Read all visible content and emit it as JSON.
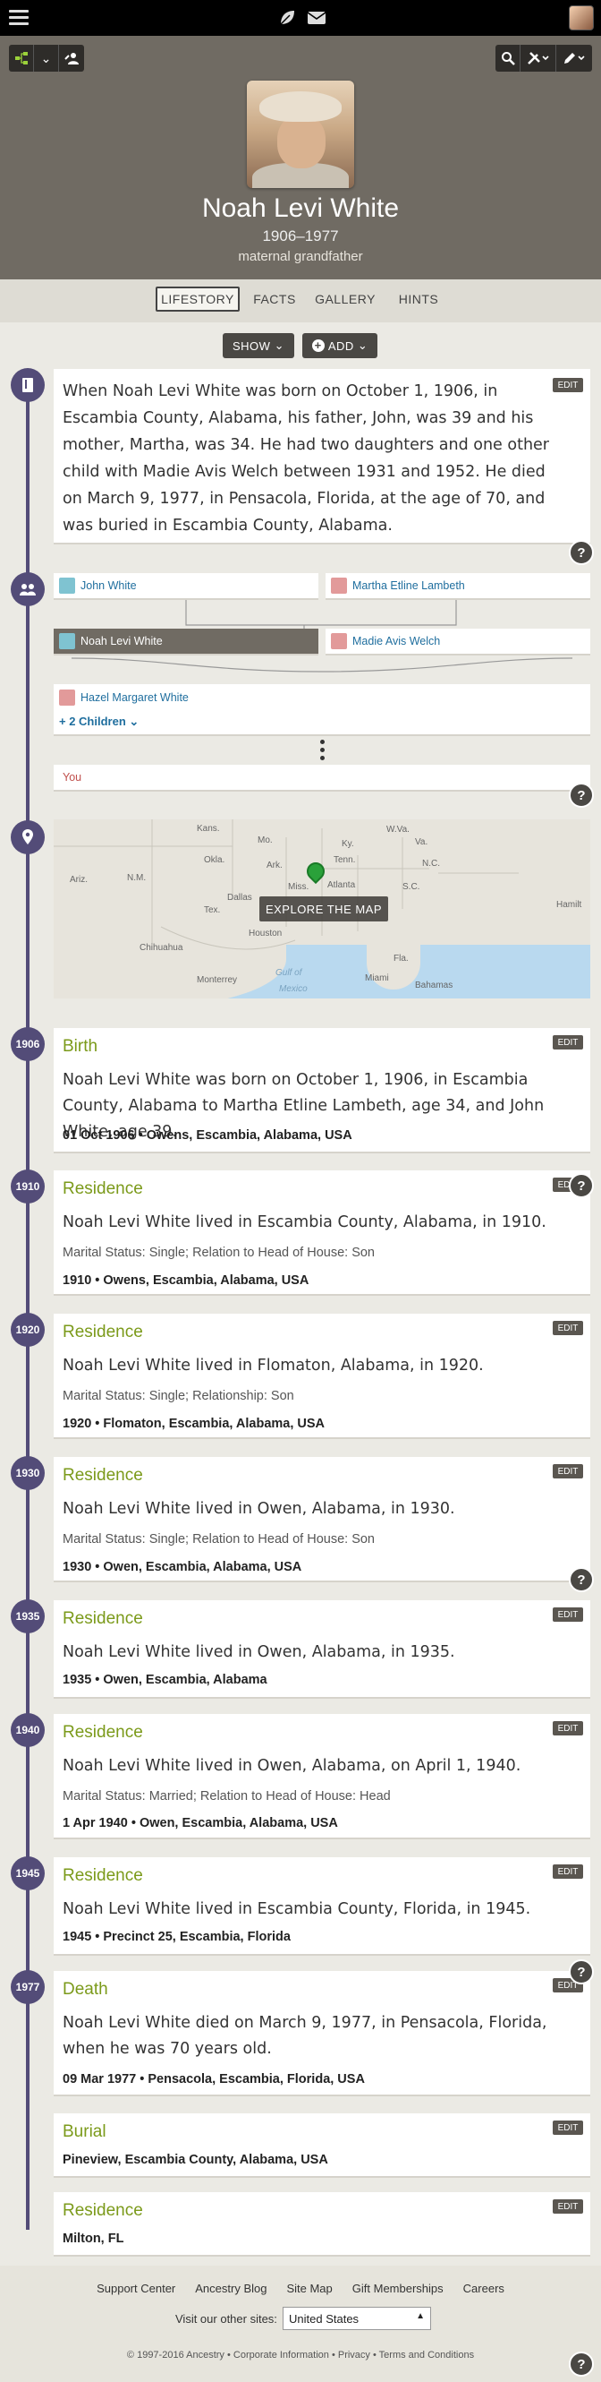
{
  "header": {
    "name": "Noah Levi White",
    "years": "1906–1977",
    "relation": "maternal grandfather"
  },
  "tabs": [
    {
      "label": "LIFESTORY"
    },
    {
      "label": "FACTS"
    },
    {
      "label": "GALLERY"
    },
    {
      "label": "HINTS"
    }
  ],
  "actions": {
    "show": "SHOW",
    "add": "ADD"
  },
  "common": {
    "edit": "EDIT",
    "help": "?"
  },
  "story": "When Noah Levi White was born on October 1, 1906, in Escambia County, Alabama, his father, John, was 39 and his mother, Martha, was 34. He had two daughters and one other child with Madie Avis Welch between 1931 and 1952. He died on March 9, 1977, in Pensacola, Florida, at the age of 70, and was buried in Escambia County, Alabama.",
  "family": {
    "father": "John White",
    "mother": "Martha Etline Lambeth",
    "self": "Noah Levi White",
    "spouse": "Madie Avis Welch",
    "child": "Hazel Margaret White",
    "more_children": "+ 2 Children",
    "you": "You"
  },
  "map": {
    "explore": "EXPLORE THE MAP",
    "labels": {
      "kans": "Kans.",
      "mo": "Mo.",
      "ky": "Ky.",
      "wva": "W.Va.",
      "va": "Va.",
      "okla": "Okla.",
      "ark": "Ark.",
      "tenn": "Tenn.",
      "nc": "N.C.",
      "ariz": "Ariz.",
      "nm": "N.M.",
      "miss": "Miss.",
      "sc": "S.C.",
      "dallas": "Dallas",
      "atlanta": "Atlanta",
      "hamilton": "Hamilt",
      "tex": "Tex.",
      "houston": "Houston",
      "chihuahua": "Chihuahua",
      "gulf": "Gulf of",
      "mexico": "Mexico",
      "monterrey": "Monterrey",
      "miami": "Miami",
      "bahamas": "Bahamas",
      "fla": "Fla."
    }
  },
  "events": [
    {
      "year": "1906",
      "title": "Birth",
      "desc": "Noah Levi White was born on October 1, 1906, in Escambia County, Alabama to Martha Etline Lambeth, age 34, and John White, age 39.",
      "sub": "",
      "loc": "01 Oct 1906 • Owens, Escambia, Alabama, USA"
    },
    {
      "year": "1910",
      "title": "Residence",
      "desc": "Noah Levi White lived in Escambia County, Alabama, in 1910.",
      "sub": "Marital Status: Single; Relation to Head of House: Son",
      "loc": "1910 • Owens, Escambia, Alabama, USA"
    },
    {
      "year": "1920",
      "title": "Residence",
      "desc": "Noah Levi White lived in Flomaton, Alabama, in 1920.",
      "sub": "Marital Status: Single; Relationship: Son",
      "loc": "1920 • Flomaton, Escambia, Alabama, USA"
    },
    {
      "year": "1930",
      "title": "Residence",
      "desc": "Noah Levi White lived in Owen, Alabama, in 1930.",
      "sub": "Marital Status: Single; Relation to Head of House: Son",
      "loc": "1930 • Owen, Escambia, Alabama, USA"
    },
    {
      "year": "1935",
      "title": "Residence",
      "desc": "Noah Levi White lived in Owen, Alabama, in 1935.",
      "sub": "",
      "loc": "1935 • Owen, Escambia, Alabama"
    },
    {
      "year": "1940",
      "title": "Residence",
      "desc": "Noah Levi White lived in Owen, Alabama, on April 1, 1940.",
      "sub": "Marital Status: Married; Relation to Head of House: Head",
      "loc": "1 Apr 1940 • Owen, Escambia, Alabama, USA"
    },
    {
      "year": "1945",
      "title": "Residence",
      "desc": "Noah Levi White lived in Escambia County, Florida, in 1945.",
      "sub": "",
      "loc": "1945 • Precinct 25, Escambia, Florida"
    },
    {
      "year": "1977",
      "title": "Death",
      "desc": "Noah Levi White died on March 9, 1977, in Pensacola, Florida, when he was 70 years old.",
      "sub": "",
      "loc": "09 Mar 1977 • Pensacola, Escambia, Florida, USA"
    },
    {
      "year": "",
      "title": "Burial",
      "desc": "",
      "sub": "",
      "loc": "Pineview, Escambia County, Alabama, USA"
    },
    {
      "year": "",
      "title": "Residence",
      "desc": "",
      "sub": "",
      "loc": "Milton, FL"
    }
  ],
  "footer": {
    "links": [
      "Support Center",
      "Ancestry Blog",
      "Site Map",
      "Gift Memberships",
      "Careers"
    ],
    "visit_label": "Visit our other sites:",
    "country": "United States",
    "copyright": "© 1997-2016 Ancestry • Corporate Information • Privacy • Terms and Conditions"
  },
  "colors": {
    "accent": "#534c78",
    "event_title": "#7b9a1a",
    "header_bg": "#706b63",
    "link": "#1f6e9e"
  },
  "icons": [
    "menu-icon",
    "leaf-icon",
    "mail-icon",
    "tree-view-icon",
    "chevron-down-icon",
    "person-edit-icon",
    "search-icon",
    "tools-icon",
    "pencil-icon",
    "book-icon",
    "family-icon",
    "map-pin-icon",
    "help-icon"
  ]
}
